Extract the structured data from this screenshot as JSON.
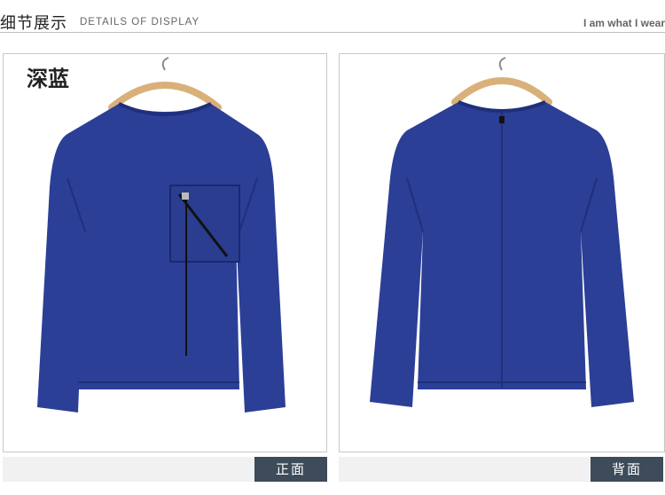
{
  "header": {
    "title_cn": "细节展示",
    "title_en": "DETAILS OF DISPLAY",
    "tagline": "I am what I wear"
  },
  "front_panel": {
    "color_label": "深蓝",
    "view_tag": "正面"
  },
  "back_panel": {
    "view_tag": "背面"
  },
  "colors": {
    "garment": "#2b3f96",
    "garment_shadow": "#1f2f7a",
    "hanger": "#d9b07a",
    "tag_bg": "#3d4b5a"
  },
  "icons": [
    "hanger-icon"
  ]
}
